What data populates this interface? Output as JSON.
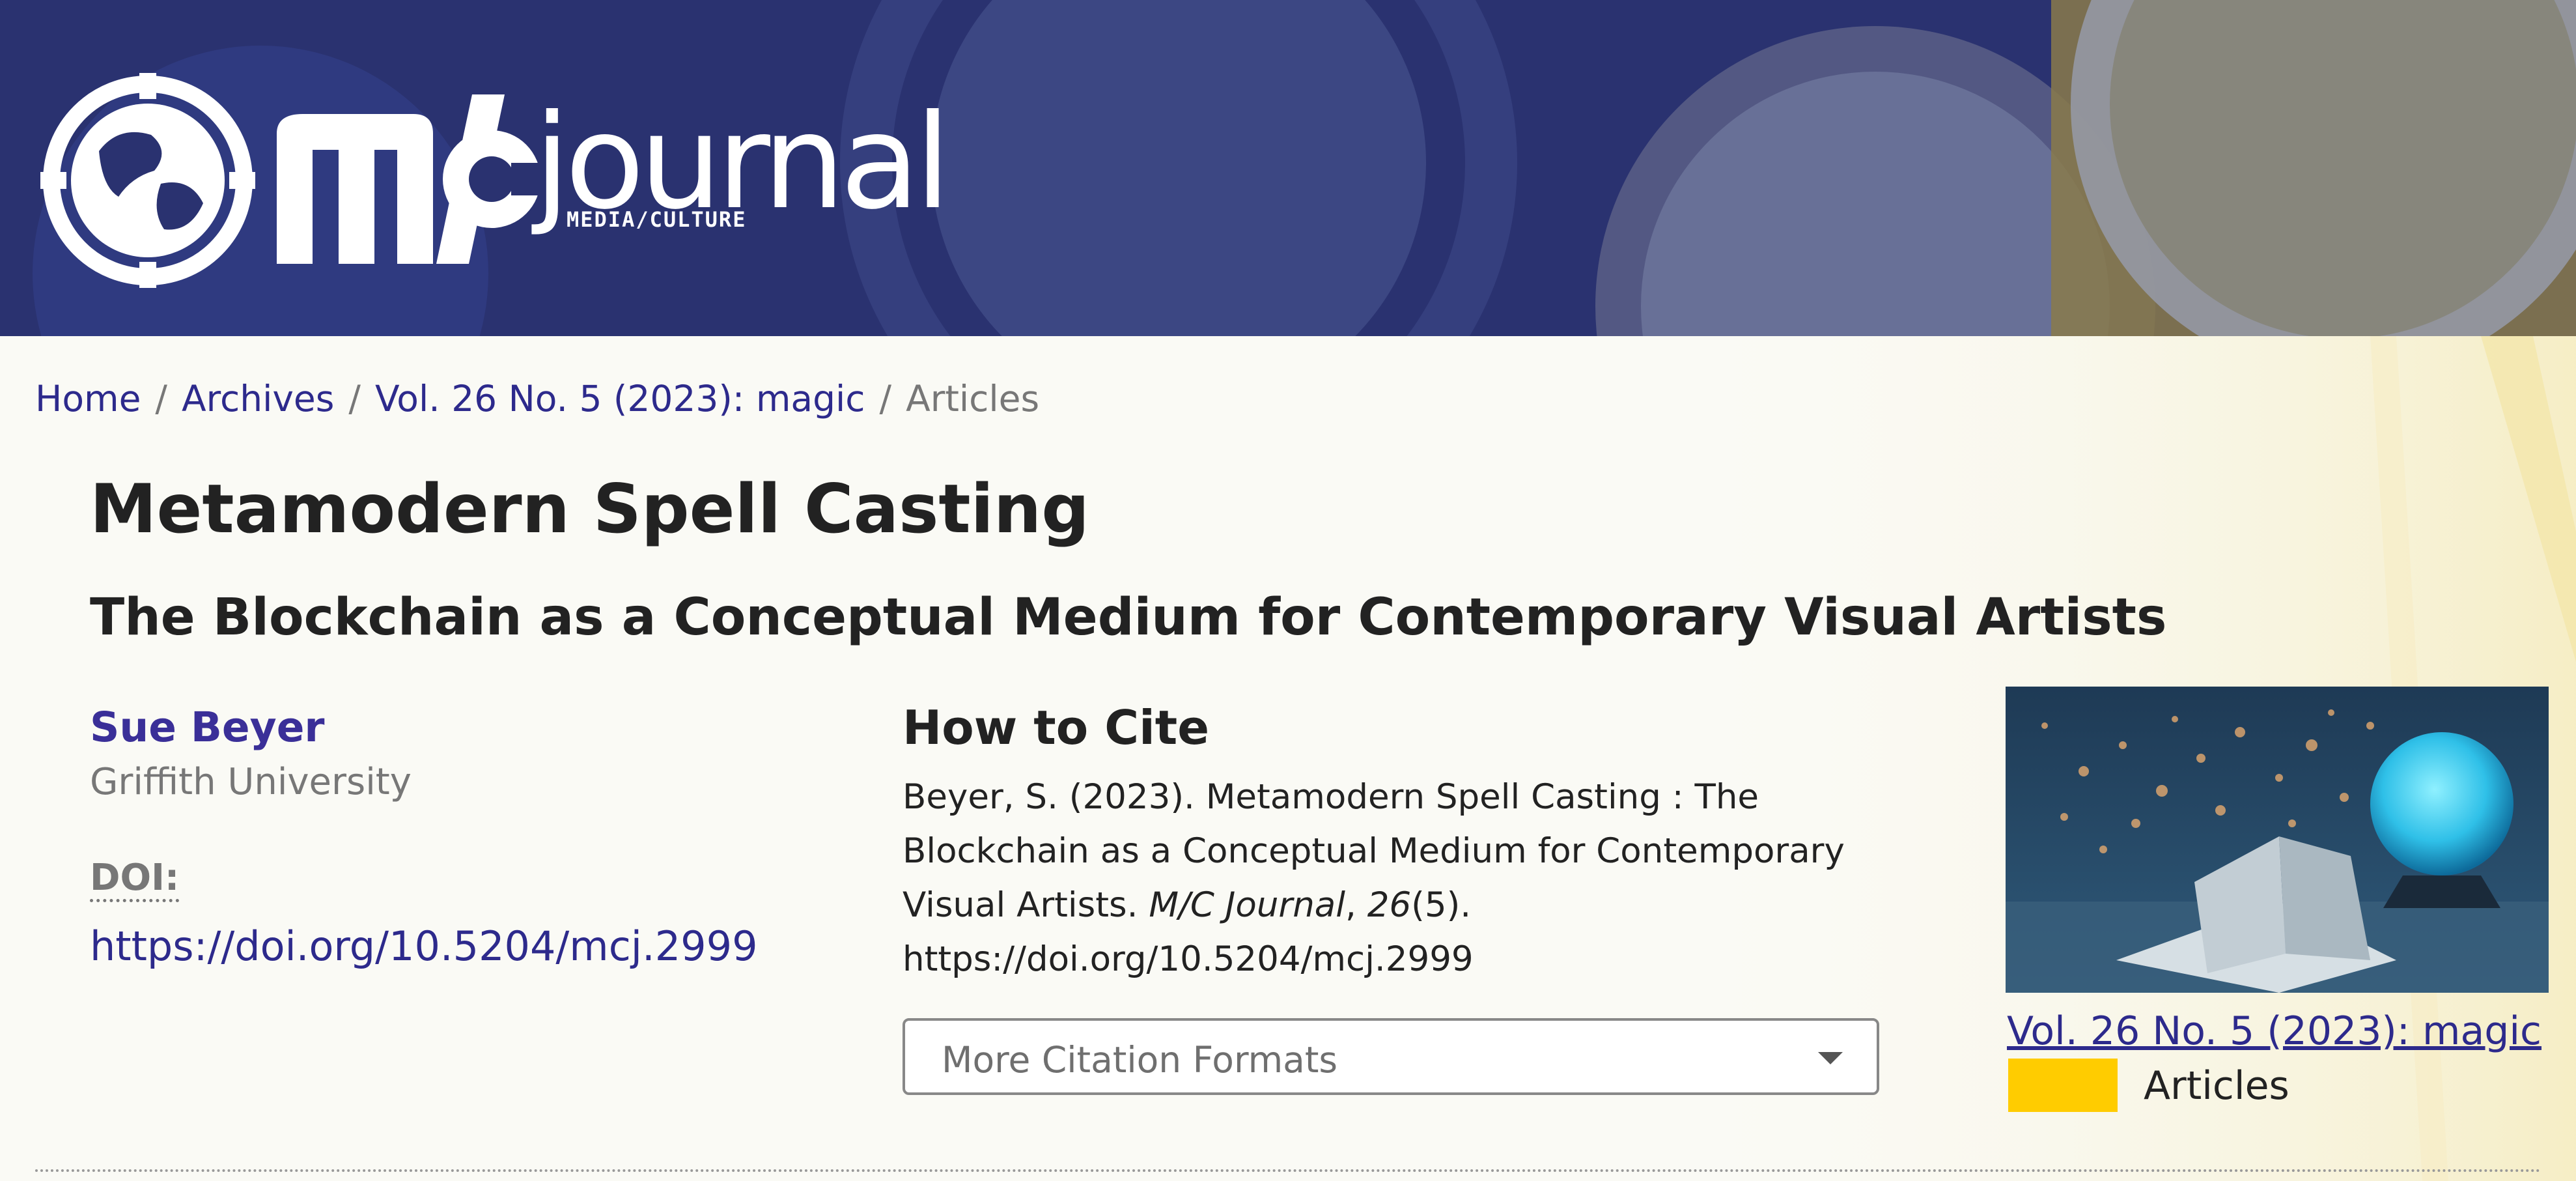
{
  "banner": {
    "logo_text": "journal",
    "logo_subtext": "MEDIA/CULTURE"
  },
  "breadcrumb": {
    "items": [
      {
        "label": "Home"
      },
      {
        "label": "Archives"
      },
      {
        "label": "Vol. 26 No. 5 (2023): magic"
      }
    ],
    "current": "Articles",
    "separator": "/"
  },
  "article": {
    "title": "Metamodern Spell Casting",
    "subtitle": "The Blockchain as a Conceptual Medium for Contemporary Visual Artists"
  },
  "author": {
    "name": "Sue Beyer",
    "affiliation": "Griffith University"
  },
  "doi": {
    "label": "DOI:",
    "url": "https://doi.org/10.5204/mcj.2999"
  },
  "citation": {
    "heading": "How to Cite",
    "text_before_journal": "Beyer, S. (2023). Metamodern Spell Casting : The Blockchain as a Conceptual Medium for Contemporary Visual Artists.",
    "journal": "M/C Journal",
    "volume": "26",
    "issue_part": "(5).",
    "doi_url": "https://doi.org/10.5204/mcj.2999",
    "formats_label": "More Citation Formats"
  },
  "issue": {
    "link_text": "Vol. 26 No. 5 (2023): magic",
    "section": "Articles"
  },
  "colors": {
    "banner_bg": "#2a3270",
    "link": "#2d2a8c",
    "author": "#3a2f98",
    "section_swatch": "#ffcc00",
    "page_bg": "#fafaf5"
  },
  "icons": {
    "globe_logo": "globe-logo-icon",
    "mc_logo": "mc-logo-icon",
    "dropdown": "chevron-down-icon"
  }
}
